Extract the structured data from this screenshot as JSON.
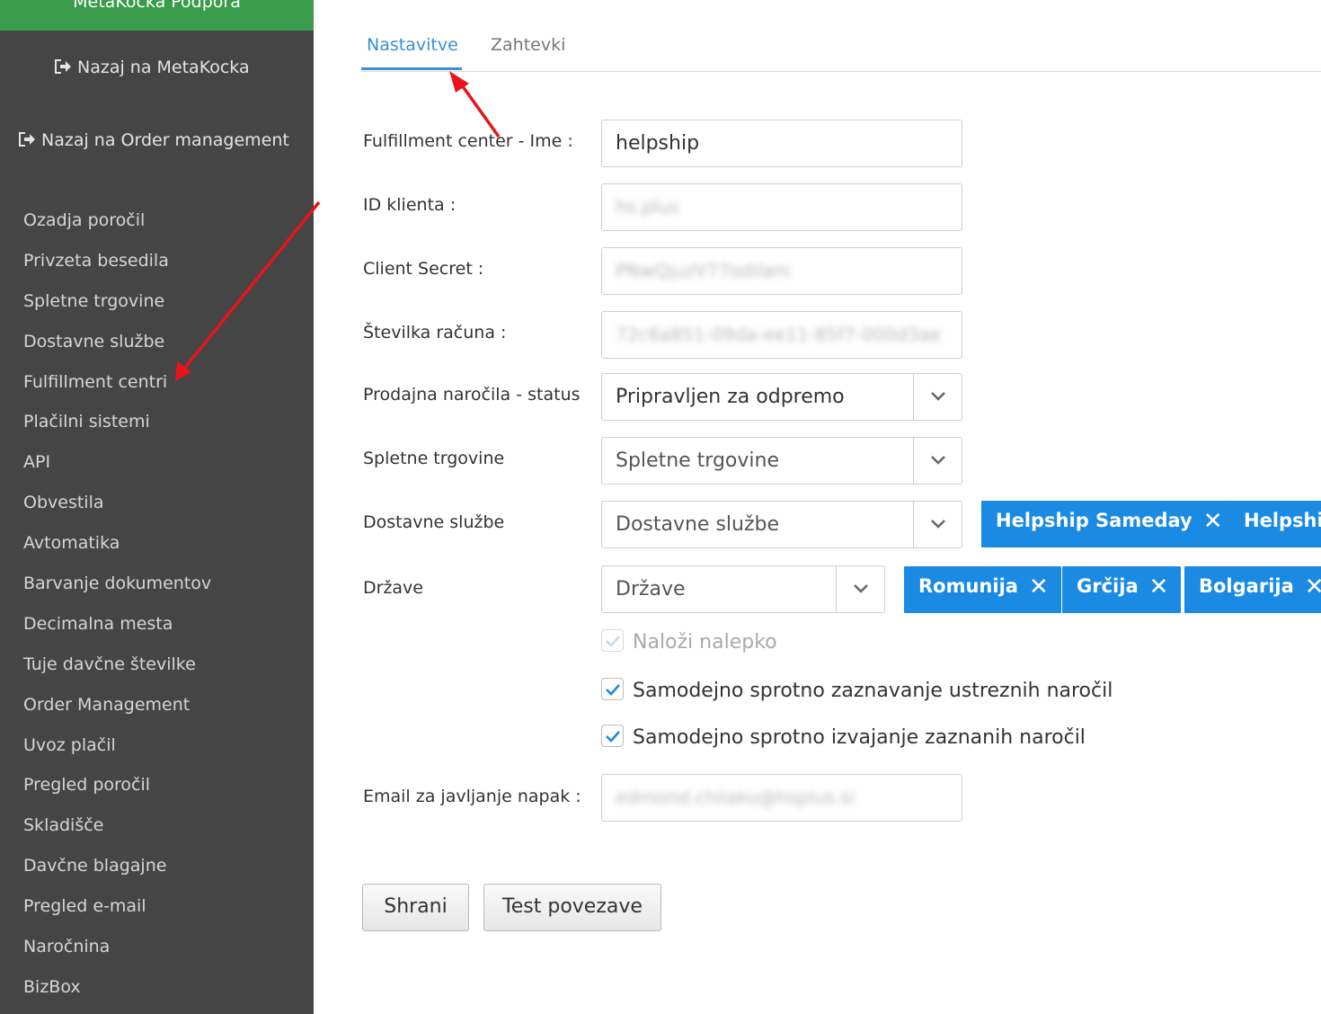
{
  "sidebar": {
    "brand": "MetaKocka Podpora",
    "back_metakocka": "Nazaj na MetaKocka",
    "back_order_mgmt": "Nazaj na Order management",
    "items": [
      {
        "label": "Ozadja poročil"
      },
      {
        "label": "Privzeta besedila"
      },
      {
        "label": "Spletne trgovine"
      },
      {
        "label": "Dostavne službe"
      },
      {
        "label": "Fulfillment centri"
      },
      {
        "label": "Plačilni sistemi"
      },
      {
        "label": "API"
      },
      {
        "label": "Obvestila"
      },
      {
        "label": "Avtomatika"
      },
      {
        "label": "Barvanje dokumentov"
      },
      {
        "label": "Decimalna mesta"
      },
      {
        "label": "Tuje davčne številke"
      },
      {
        "label": "Order Management"
      },
      {
        "label": "Uvoz plačil"
      },
      {
        "label": "Pregled poročil"
      },
      {
        "label": "Skladišče"
      },
      {
        "label": "Davčne blagajne"
      },
      {
        "label": "Pregled e-mail"
      },
      {
        "label": "Naročnina"
      },
      {
        "label": "BizBox"
      }
    ]
  },
  "tabs": {
    "active": "Nastavitve",
    "second": "Zahtevki"
  },
  "form": {
    "name_label": "Fulfillment center - Ime :",
    "name_value": "helpship",
    "client_id_label": "ID klienta :",
    "client_id_value": "hs.plus",
    "secret_label": "Client Secret :",
    "secret_value": "PNwQjuzV77odilam",
    "account_label": "Številka računa :",
    "account_value": "72c6a851-09da-ee11-85f7-000d3ae",
    "status_label": "Prodajna naročila - status",
    "status_value": "Pripravljen za odpremo",
    "shops_label": "Spletne trgovine",
    "shops_placeholder": "Spletne trgovine",
    "delivery_label": "Dostavne službe",
    "delivery_placeholder": "Dostavne službe",
    "delivery_tags": [
      "Helpship Sameday",
      "Helpship"
    ],
    "countries_label": "Države",
    "countries_placeholder": "Države",
    "country_tags": [
      "Romunija",
      "Grčija",
      "Bolgarija"
    ],
    "cb_label": "Naloži nalepko",
    "cb_detect": "Samodejno sprotno zaznavanje ustreznih naročil",
    "cb_execute": "Samodejno sprotno izvajanje zaznanih naročil",
    "email_label": "Email za javljanje napak :",
    "email_value": "edmond.chilaku@hsplus.si",
    "save_button": "Shrani",
    "test_button": "Test povezave"
  },
  "colors": {
    "sidebar_bg": "#454545",
    "brand_bg": "#3a9c4a",
    "accent": "#3a8fd6",
    "tag_bg": "#1a8ae3",
    "annotation_arrow": "#e8141c"
  },
  "icons": {
    "back": "sign-out-icon",
    "select": "chevron-down-icon",
    "tag_remove": "close-icon",
    "checkbox": "check-icon"
  }
}
